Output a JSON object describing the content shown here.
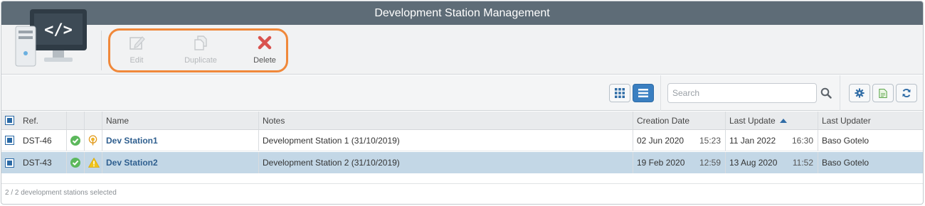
{
  "window": {
    "title": "Development Station Management"
  },
  "toolbar": {
    "edit_label": "Edit",
    "duplicate_label": "Duplicate",
    "delete_label": "Delete",
    "highlight_color": "#f0883a",
    "delete_icon_color": "#d9534f"
  },
  "viewbar": {
    "grid_view_icon": "grid-icon",
    "list_view_icon": "list-icon",
    "search_placeholder": "Search",
    "search_value": "",
    "settings_icon": "gear-icon",
    "export_icon": "document-icon",
    "refresh_icon": "refresh-icon"
  },
  "table": {
    "columns": {
      "ref": "Ref.",
      "name": "Name",
      "notes": "Notes",
      "creation_date": "Creation Date",
      "last_update": "Last Update",
      "last_updater": "Last Updater"
    },
    "sort": {
      "column": "Last Update",
      "direction": "ascending"
    },
    "rows": [
      {
        "ref": "DST-46",
        "status_icon": "check-circle-icon",
        "type_icon": "broadcast-icon",
        "name": "Dev Station1",
        "notes": "Development Station 1 (31/10/2019)",
        "creation_date": "02 Jun 2020",
        "creation_time": "15:23",
        "update_date": "11 Jan 2022",
        "update_time": "16:30",
        "updater": "Baso Gotelo",
        "selected": true
      },
      {
        "ref": "DST-43",
        "status_icon": "check-circle-icon",
        "type_icon": "warning-icon",
        "name": "Dev Station2",
        "notes": "Development Station 2 (31/10/2019)",
        "creation_date": "19 Feb 2020",
        "creation_time": "12:59",
        "update_date": "13 Aug 2020",
        "update_time": "11:52",
        "updater": "Baso Gotelo",
        "selected": true
      }
    ]
  },
  "footer": {
    "selection_text": "2 / 2 development stations selected"
  },
  "colors": {
    "titlebar": "#5e6c77",
    "selected_row": "#c3d7e6",
    "link": "#2f5f8f",
    "ok_green": "#5cb85c",
    "warning_yellow": "#f0c419",
    "accent_blue": "#3a7fc1"
  }
}
